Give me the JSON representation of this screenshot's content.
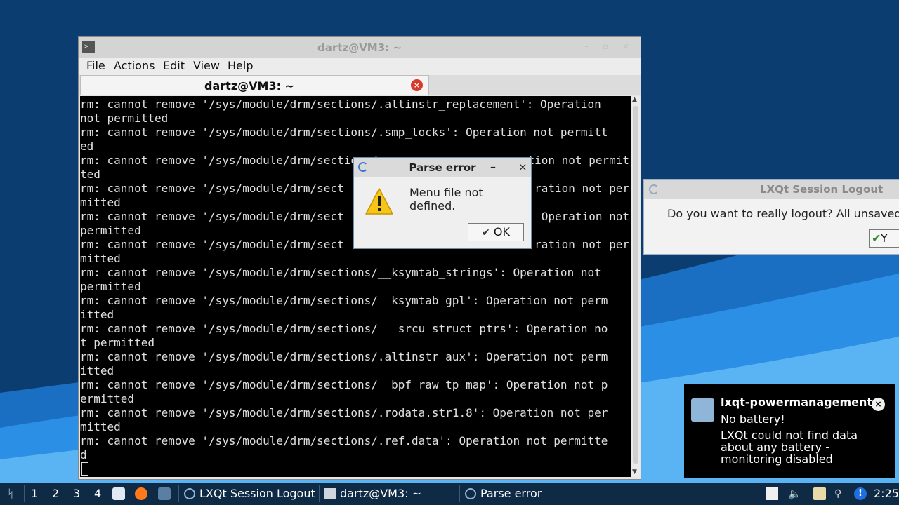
{
  "terminal": {
    "window_title": "dartz@VM3: ~",
    "menu": [
      "File",
      "Actions",
      "Edit",
      "View",
      "Help"
    ],
    "tab_label": "dartz@VM3: ~",
    "lines": [
      "rm: cannot remove '/sys/module/drm/sections/.altinstr_replacement': Operation",
      "not permitted",
      "rm: cannot remove '/sys/module/drm/sections/.smp_locks': Operation not permitt",
      "ed",
      "rm: cannot remove '/sys/module/drm/sections/.",
      "ted",
      "rm: cannot remove '/sys/module/drm/sect",
      "mitted",
      "rm: cannot remove '/sys/module/drm/sect",
      "permitted",
      "rm: cannot remove '/sys/module/drm/sect",
      "mitted",
      "rm: cannot remove '/sys/module/drm/sections/__ksymtab_strings': Operation not",
      "permitted",
      "rm: cannot remove '/sys/module/drm/sections/__ksymtab_gpl': Operation not perm",
      "itted",
      "rm: cannot remove '/sys/module/drm/sections/___srcu_struct_ptrs': Operation no",
      "t permitted",
      "rm: cannot remove '/sys/module/drm/sections/.altinstr_aux': Operation not perm",
      "itted",
      "rm: cannot remove '/sys/module/drm/sections/__bpf_raw_tp_map': Operation not p",
      "ermitted",
      "rm: cannot remove '/sys/module/drm/sections/.rodata.str1.8': Operation not per",
      "mitted",
      "rm: cannot remove '/sys/module/drm/sections/.ref.data': Operation not permitte",
      "d"
    ],
    "line_tails": [
      {
        "row": 4,
        "text": "tion not permit"
      },
      {
        "row": 6,
        "text": "ration not per"
      },
      {
        "row": 8,
        "text": "Operation not"
      },
      {
        "row": 10,
        "text": "ration not per"
      }
    ]
  },
  "parse_error": {
    "title": "Parse error",
    "minimize": "–",
    "close": "×",
    "message": "Menu file not defined.",
    "ok_label": "OK",
    "ok_icon": "✔"
  },
  "logout_dialog": {
    "title": "LXQt Session Logout",
    "message": "Do you want to really logout? All unsaved w",
    "yes_label": "Y",
    "yes_icon": "✔"
  },
  "notification": {
    "title": "lxqt-powermanagement",
    "close": "×",
    "headline": "No battery!",
    "body": "LXQt could not find data about any battery - monitoring disabled"
  },
  "taskbar": {
    "desktops": [
      "1",
      "2",
      "3",
      "4"
    ],
    "tasks": [
      "LXQt Session Logout",
      "dartz@VM3: ~",
      "Parse error"
    ],
    "clock": "2:25"
  }
}
